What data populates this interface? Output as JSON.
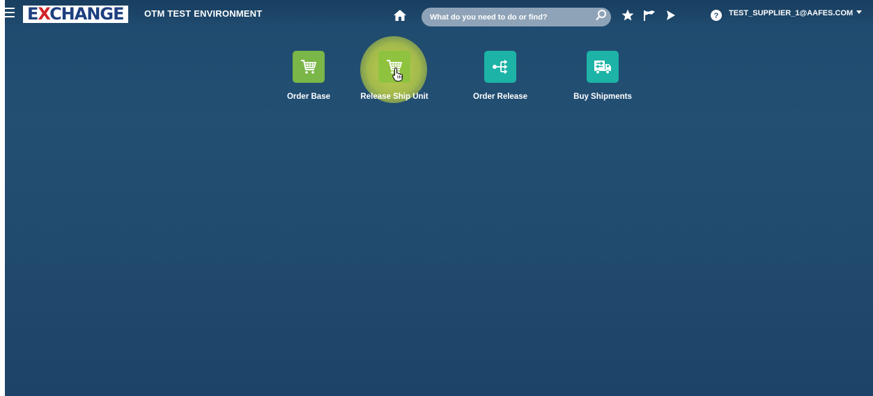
{
  "header": {
    "brand_prefix": "E",
    "brand_x": "X",
    "brand_rest": "CHANGE",
    "environment_title": "OTM TEST ENVIRONMENT",
    "search_placeholder": "What do you need to do or find?",
    "user_label": "TEST_SUPPLIER_1@AAFES.COM",
    "icons": [
      "menu-icon",
      "home-icon",
      "search-icon",
      "star-icon",
      "flag-icon",
      "bell-icon",
      "help-icon",
      "chevron-down-icon"
    ]
  },
  "tiles": [
    {
      "label": "Order Base",
      "icon": "cart-icon",
      "color": "#7ab648"
    },
    {
      "label": "Release Ship Unit",
      "icon": "cart-icon",
      "color": "#8fc33f",
      "state": "hovered"
    },
    {
      "label": "Order Release",
      "icon": "order-release-icon",
      "color": "#1db3a6"
    },
    {
      "label": "Buy Shipments",
      "icon": "truck-icon",
      "color": "#1db3a6"
    }
  ],
  "colors": {
    "background": "#1f4a6f",
    "search_bg": "#8ea3b7",
    "logo_blue": "#1d3f80",
    "logo_red": "#d2232a",
    "hover_halo": "#c8d650"
  }
}
